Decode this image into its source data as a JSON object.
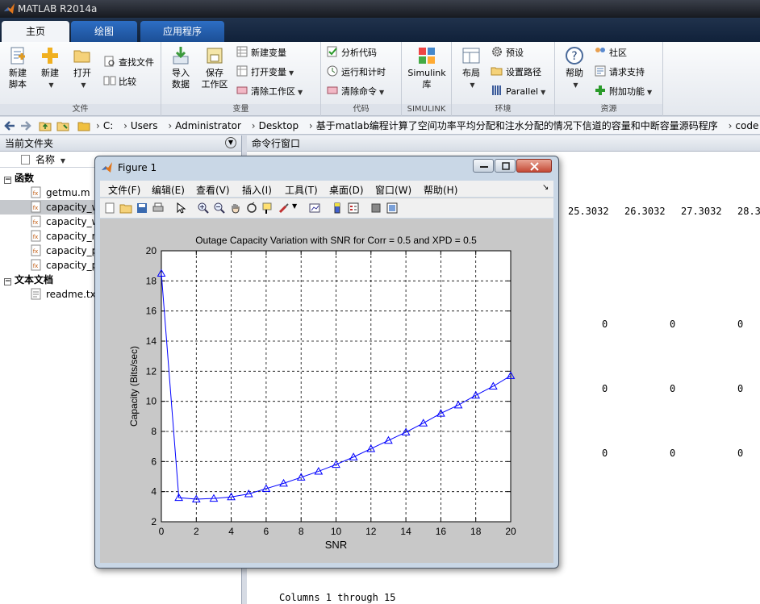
{
  "window": {
    "title": "MATLAB R2014a"
  },
  "tabs": [
    {
      "label": "主页",
      "active": true
    },
    {
      "label": "绘图",
      "active": false
    },
    {
      "label": "应用程序",
      "active": false
    }
  ],
  "ribbon": {
    "file": {
      "label": "文件",
      "new_script": "新建\n脚本",
      "new": "新建",
      "open": "打开",
      "find_files": "查找文件",
      "compare": "比较"
    },
    "variable": {
      "label": "变量",
      "import": "导入\n数据",
      "save_ws": "保存\n工作区",
      "new_var": "新建变量",
      "open_var": "打开变量",
      "clear_ws": "清除工作区"
    },
    "code": {
      "label": "代码",
      "analyze": "分析代码",
      "run_time": "运行和计时",
      "clear_cmd": "清除命令"
    },
    "simulink": {
      "label": "SIMULINK",
      "lib": "Simulink\n库"
    },
    "env": {
      "label": "环境",
      "layout": "布局",
      "prefs": "预设",
      "set_path": "设置路径",
      "parallel": "Parallel"
    },
    "resources": {
      "label": "资源",
      "help": "帮助",
      "community": "社区",
      "support": "请求支持",
      "addons": "附加功能"
    }
  },
  "address": {
    "crumbs": [
      "C:",
      "Users",
      "Administrator",
      "Desktop",
      "基于matlab编程计算了空间功率平均分配和注水分配的情况下信道的容量和中断容量源码程序",
      "code"
    ]
  },
  "current_folder": {
    "title": "当前文件夹",
    "column_name": "名称",
    "groups": [
      {
        "label": "函数",
        "files": [
          "getmu.m",
          "capacity_w",
          "capacity_w",
          "capacity_ri",
          "capacity_p",
          "capacity_p"
        ]
      },
      {
        "label": "文本文档",
        "files": [
          "readme.txt"
        ]
      }
    ]
  },
  "command_window": {
    "title": "命令行窗口",
    "header_cols": [
      "25.3032",
      "26.3032",
      "27.3032",
      "28.3"
    ],
    "zero_rows": [
      [
        "0",
        "0",
        "0"
      ],
      [
        "0",
        "0",
        "0"
      ],
      [
        "0",
        "0",
        "0"
      ]
    ],
    "footer": "Columns 1 through 15"
  },
  "figure": {
    "title": "Figure 1",
    "menu": [
      "文件(F)",
      "编辑(E)",
      "查看(V)",
      "插入(I)",
      "工具(T)",
      "桌面(D)",
      "窗口(W)",
      "帮助(H)"
    ]
  },
  "chart_data": {
    "type": "line",
    "title": "Outage Capacity Variation with SNR for Corr = 0.5 and XPD = 0.5",
    "xlabel": "SNR",
    "ylabel": "Capacity (Bits/sec)",
    "xlim": [
      0,
      20
    ],
    "ylim": [
      2,
      20
    ],
    "xticks": [
      0,
      2,
      4,
      6,
      8,
      10,
      12,
      14,
      16,
      18,
      20
    ],
    "yticks": [
      2,
      4,
      6,
      8,
      10,
      12,
      14,
      16,
      18,
      20
    ],
    "grid": true,
    "marker": "triangle",
    "color": "#0000ff",
    "x": [
      0,
      1,
      2,
      3,
      4,
      5,
      6,
      7,
      8,
      9,
      10,
      11,
      12,
      13,
      14,
      15,
      16,
      17,
      18,
      19,
      20
    ],
    "y": [
      18.5,
      3.6,
      3.5,
      3.55,
      3.65,
      3.85,
      4.2,
      4.55,
      4.95,
      5.35,
      5.8,
      6.3,
      6.85,
      7.4,
      7.95,
      8.55,
      9.2,
      9.75,
      10.4,
      11.0,
      11.7
    ]
  }
}
